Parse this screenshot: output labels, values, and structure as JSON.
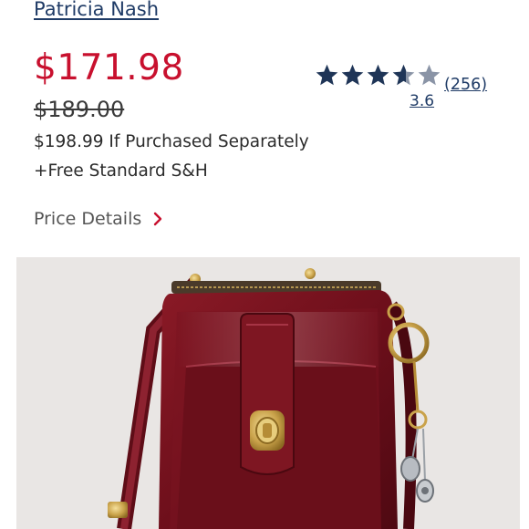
{
  "product": {
    "brand": "Patricia Nash",
    "price": "$171.98",
    "original_price": "$189.00",
    "separate_price_note": "$198.99 If Purchased Separately",
    "shipping_note": "+Free Standard S&H",
    "price_details_label": "Price Details"
  },
  "rating": {
    "average": "3.6",
    "review_count": "(256)",
    "stars_value": 3.6,
    "max_stars": 5
  },
  "colors": {
    "price": "#c8102e",
    "link": "#1f3b66",
    "star_filled": "#1f3557",
    "star_empty": "#8a94a6",
    "chevron": "#c8102e"
  },
  "image": {
    "subject": "red leather crossbody phone wallet bag"
  }
}
